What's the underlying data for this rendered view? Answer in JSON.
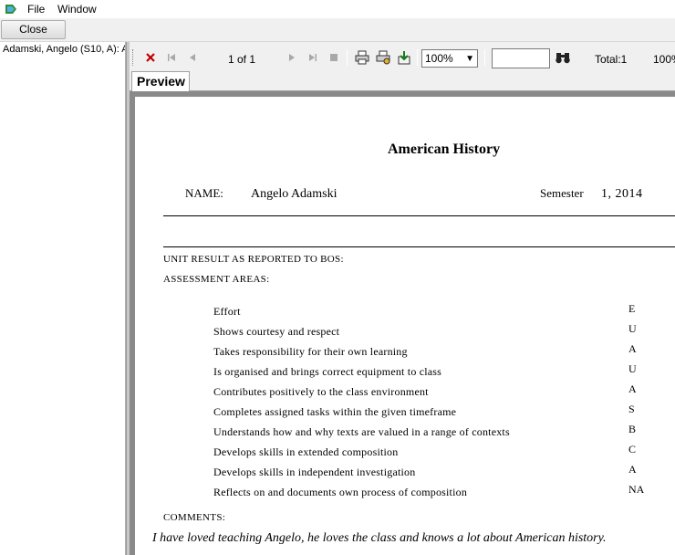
{
  "menu": {
    "file": "File",
    "window": "Window"
  },
  "topbar": {
    "close_label": "Close"
  },
  "left_panel": {
    "items": [
      "Adamski, Angelo (S10, A): A"
    ]
  },
  "toolbar": {
    "page_indicator": "1 of 1",
    "zoom_value": "100%",
    "search_value": "",
    "total": "Total:1",
    "zoom_right": "100%"
  },
  "tabs": [
    "Preview"
  ],
  "report": {
    "title": "American History",
    "name_label": "NAME:",
    "name_value": "Angelo Adamski",
    "semester_label": "Semester",
    "semester_value": "1, 2014",
    "unit_result_label": "UNIT RESULT AS REPORTED TO BOS:",
    "assessment_label": "ASSESSMENT AREAS:",
    "rows": [
      {
        "area": "Effort",
        "grade": "E"
      },
      {
        "area": "Shows courtesy and respect",
        "grade": "U"
      },
      {
        "area": "Takes responsibility for their own learning",
        "grade": "A"
      },
      {
        "area": "Is organised and brings correct equipment to class",
        "grade": "U"
      },
      {
        "area": "Contributes positively to the class environment",
        "grade": "A"
      },
      {
        "area": "Completes assigned tasks within the given timeframe",
        "grade": "S"
      },
      {
        "area": "Understands how and why texts are valued in a range of contexts",
        "grade": "B"
      },
      {
        "area": "Develops skills in extended composition",
        "grade": "C"
      },
      {
        "area": "Develops skills in independent investigation",
        "grade": "A"
      },
      {
        "area": "Reflects on and documents own process of composition",
        "grade": "NA"
      }
    ],
    "comments_label": "COMMENTS:",
    "comment_text": "I have loved teaching Angelo, he loves the class and knows a lot about American history."
  },
  "colors": {
    "cancel_icon": "#c00000",
    "splitter": "#c8c8c8",
    "preview_bg": "#8a8a8a"
  }
}
